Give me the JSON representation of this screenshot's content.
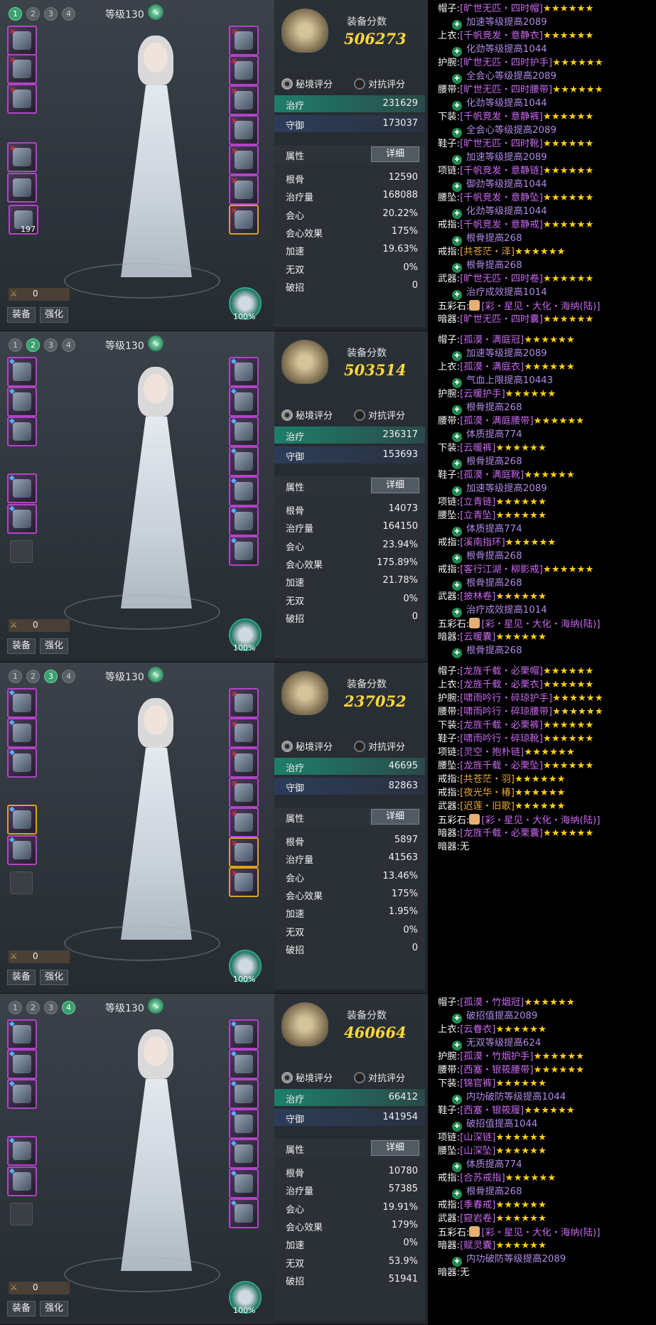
{
  "panels": [
    {
      "tabs": [
        "1",
        "2",
        "3",
        "4"
      ],
      "active_tab": 0,
      "level": "等级130",
      "slot_count": "197",
      "bottom_value": "0",
      "btn_equip": "装备",
      "btn_enhance": "强化",
      "pet_pct": "100%",
      "score_label": "装备分数",
      "score": "506273",
      "radio_a": "秘境评分",
      "radio_b": "对抗评分",
      "heal_k": "治疗",
      "heal_v": "231629",
      "def_k": "守御",
      "def_v": "173037",
      "attr_title": "属性",
      "detail_btn": "详细",
      "attrs": [
        [
          "根骨",
          "12590"
        ],
        [
          "治疗量",
          "168088"
        ],
        [
          "会心",
          "20.22%"
        ],
        [
          "会心效果",
          "175%"
        ],
        [
          "加速",
          "19.63%"
        ],
        [
          "无双",
          "0%"
        ],
        [
          "破招",
          "0"
        ]
      ]
    },
    {
      "tabs": [
        "1",
        "2",
        "3",
        "4"
      ],
      "active_tab": 1,
      "level": "等级130",
      "slot_count": "",
      "bottom_value": "0",
      "btn_equip": "装备",
      "btn_enhance": "强化",
      "pet_pct": "100%",
      "score_label": "装备分数",
      "score": "503514",
      "radio_a": "秘境评分",
      "radio_b": "对抗评分",
      "heal_k": "治疗",
      "heal_v": "236317",
      "def_k": "守御",
      "def_v": "153693",
      "attr_title": "属性",
      "detail_btn": "详细",
      "attrs": [
        [
          "根骨",
          "14073"
        ],
        [
          "治疗量",
          "164150"
        ],
        [
          "会心",
          "23.94%"
        ],
        [
          "会心效果",
          "175.89%"
        ],
        [
          "加速",
          "21.78%"
        ],
        [
          "无双",
          "0%"
        ],
        [
          "破招",
          "0"
        ]
      ]
    },
    {
      "tabs": [
        "1",
        "2",
        "3",
        "4"
      ],
      "active_tab": 2,
      "level": "等级130",
      "slot_count": "",
      "bottom_value": "0",
      "btn_equip": "装备",
      "btn_enhance": "强化",
      "pet_pct": "100%",
      "score_label": "装备分数",
      "score": "237052",
      "radio_a": "秘境评分",
      "radio_b": "对抗评分",
      "heal_k": "治疗",
      "heal_v": "46695",
      "def_k": "守御",
      "def_v": "82863",
      "attr_title": "属性",
      "detail_btn": "详细",
      "attrs": [
        [
          "根骨",
          "5897"
        ],
        [
          "治疗量",
          "41563"
        ],
        [
          "会心",
          "13.46%"
        ],
        [
          "会心效果",
          "175%"
        ],
        [
          "加速",
          "1.95%"
        ],
        [
          "无双",
          "0%"
        ],
        [
          "破招",
          "0"
        ]
      ]
    },
    {
      "tabs": [
        "1",
        "2",
        "3",
        "4"
      ],
      "active_tab": 3,
      "level": "等级130",
      "slot_count": "",
      "bottom_value": "0",
      "btn_equip": "装备",
      "btn_enhance": "强化",
      "pet_pct": "100%",
      "score_label": "装备分数",
      "score": "460664",
      "radio_a": "秘境评分",
      "radio_b": "对抗评分",
      "heal_k": "治疗",
      "heal_v": "66412",
      "def_k": "守御",
      "def_v": "141954",
      "attr_title": "属性",
      "detail_btn": "详细",
      "attrs": [
        [
          "根骨",
          "10780"
        ],
        [
          "治疗量",
          "57385"
        ],
        [
          "会心",
          "19.91%"
        ],
        [
          "会心效果",
          "179%"
        ],
        [
          "加速",
          "0%"
        ],
        [
          "无双",
          "53.9%"
        ],
        [
          "破招",
          "51941"
        ]
      ]
    }
  ],
  "lists": [
    [
      {
        "k": "帽子:",
        "n": "[旷世无匹・四时帽]",
        "s": "★★★★★★"
      },
      {
        "sub": "加速等级提高2089"
      },
      {
        "k": "上衣:",
        "n": "[千帆竞发・意静衣]",
        "s": "★★★★★★"
      },
      {
        "sub": "化劲等级提高1044"
      },
      {
        "k": "护腕:",
        "n": "[旷世无匹・四时护手]",
        "s": "★★★★★★"
      },
      {
        "sub": "全会心等级提高2089"
      },
      {
        "k": "腰带:",
        "n": "[旷世无匹・四时腰带]",
        "s": "★★★★★★"
      },
      {
        "sub": "化劲等级提高1044"
      },
      {
        "k": "下装:",
        "n": "[千帆竞发・意静裤]",
        "s": "★★★★★★"
      },
      {
        "sub": "全会心等级提高2089"
      },
      {
        "k": "鞋子:",
        "n": "[旷世无匹・四时靴]",
        "s": "★★★★★★"
      },
      {
        "sub": "加速等级提高2089"
      },
      {
        "k": "项链:",
        "n": "[千帆竞发・意静链]",
        "s": "★★★★★★"
      },
      {
        "sub": "御劲等级提高1044"
      },
      {
        "k": "腰坠:",
        "n": "[千帆竞发・意静坠]",
        "s": "★★★★★★"
      },
      {
        "sub": "化劲等级提高1044"
      },
      {
        "k": "戒指:",
        "n": "[千帆竞发・意静戒]",
        "s": "★★★★★★"
      },
      {
        "sub": "根骨提高268"
      },
      {
        "k": "戒指:",
        "n": "[共苍茫・泽]",
        "s": "★★★★★★",
        "gold": true
      },
      {
        "sub": "根骨提高268"
      },
      {
        "k": "武器:",
        "n": "[旷世无匹・四时卷]",
        "s": "★★★★★★"
      },
      {
        "sub": "治疗成效提高1014"
      },
      {
        "k": "五彩石:",
        "n": "[彩・星见・大化・海纳(陆)]",
        "gem": true
      },
      {
        "k": "暗器:",
        "n": "[旷世无匹・四时囊]",
        "s": "★★★★★★"
      }
    ],
    [
      {
        "k": "帽子:",
        "n": "[孤漠・满庭冠]",
        "s": "★★★★★★"
      },
      {
        "sub": "加速等级提高2089"
      },
      {
        "k": "上衣:",
        "n": "[孤漠・满庭衣]",
        "s": "★★★★★★"
      },
      {
        "sub": "气血上限提高10443"
      },
      {
        "k": "护腕:",
        "n": "[云暖护手]",
        "s": "★★★★★★"
      },
      {
        "sub": "根骨提高268"
      },
      {
        "k": "腰带:",
        "n": "[孤漠・满庭腰带]",
        "s": "★★★★★★"
      },
      {
        "sub": "体质提高774"
      },
      {
        "k": "下装:",
        "n": "[云暖裤]",
        "s": "★★★★★★"
      },
      {
        "sub": "根骨提高268"
      },
      {
        "k": "鞋子:",
        "n": "[孤漠・满庭靴]",
        "s": "★★★★★★"
      },
      {
        "sub": "加速等级提高2089"
      },
      {
        "k": "项链:",
        "n": "[立青链]",
        "s": "★★★★★★"
      },
      {
        "k": "腰坠:",
        "n": "[立青坠]",
        "s": "★★★★★★"
      },
      {
        "sub": "体质提高774"
      },
      {
        "k": "戒指:",
        "n": "[溪南指环]",
        "s": "★★★★★★"
      },
      {
        "sub": "根骨提高268"
      },
      {
        "k": "戒指:",
        "n": "[客行江湖・柳影戒]",
        "s": "★★★★★★"
      },
      {
        "sub": "根骨提高268"
      },
      {
        "k": "武器:",
        "n": "[披林卷]",
        "s": "★★★★★★"
      },
      {
        "sub": "治疗成效提高1014"
      },
      {
        "k": "五彩石:",
        "n": "[彩・星见・大化・海纳(陆)]",
        "gem": true
      },
      {
        "k": "暗器:",
        "n": "[云暖囊]",
        "s": "★★★★★★"
      },
      {
        "sub": "根骨提高268"
      }
    ],
    [
      {
        "k": "帽子:",
        "n": "[龙旌千载・必栗帽]",
        "s": "★★★★★★"
      },
      {
        "k": "上衣:",
        "n": "[龙旌千载・必栗衣]",
        "s": "★★★★★★"
      },
      {
        "k": "护腕:",
        "n": "[啸雨吟行・碎琼护手]",
        "s": "★★★★★★"
      },
      {
        "k": "腰带:",
        "n": "[啸雨吟行・碎琼腰带]",
        "s": "★★★★★★"
      },
      {
        "k": "下装:",
        "n": "[龙旌千载・必栗裤]",
        "s": "★★★★★★"
      },
      {
        "k": "鞋子:",
        "n": "[啸雨吟行・碎琼靴]",
        "s": "★★★★★★"
      },
      {
        "k": "项链:",
        "n": "[灵空・抱朴链]",
        "s": "★★★★★★"
      },
      {
        "k": "腰坠:",
        "n": "[龙旌千载・必栗坠]",
        "s": "★★★★★★"
      },
      {
        "k": "戒指:",
        "n": "[共苍茫・羽]",
        "s": "★★★★★★",
        "gold": true
      },
      {
        "k": "戒指:",
        "n": "[夜光华・椿]",
        "s": "★★★★★★",
        "gold": true
      },
      {
        "k": "武器:",
        "n": "[迟莲・旧歌]",
        "s": "★★★★★★",
        "gold": true
      },
      {
        "k": "五彩石:",
        "n": "[彩・星见・大化・海纳(陆)]",
        "gem": true
      },
      {
        "k": "暗器:",
        "n": "[龙旌千载・必栗囊]",
        "s": "★★★★★★"
      },
      {
        "k": "暗器:",
        "plain": "无"
      }
    ],
    [
      {
        "k": "帽子:",
        "n": "[孤漠・竹烟冠]",
        "s": "★★★★★★"
      },
      {
        "sub": "破招值提高2089"
      },
      {
        "k": "上衣:",
        "n": "[云眷衣]",
        "s": "★★★★★★"
      },
      {
        "sub": "无双等级提高624"
      },
      {
        "k": "护腕:",
        "n": "[孤漠・竹烟护手]",
        "s": "★★★★★★"
      },
      {
        "k": "腰带:",
        "n": "[西塞・银筱腰带]",
        "s": "★★★★★★"
      },
      {
        "k": "下装:",
        "n": "[锦官裤]",
        "s": "★★★★★★"
      },
      {
        "sub": "内功破防等级提高1044"
      },
      {
        "k": "鞋子:",
        "n": "[西塞・银筱履]",
        "s": "★★★★★★"
      },
      {
        "sub": "破招值提高1044"
      },
      {
        "k": "项链:",
        "n": "[山深链]",
        "s": "★★★★★★"
      },
      {
        "k": "腰坠:",
        "n": "[山深坠]",
        "s": "★★★★★★"
      },
      {
        "sub": "体质提高774"
      },
      {
        "k": "戒指:",
        "n": "[合苏戒指]",
        "s": "★★★★★★"
      },
      {
        "sub": "根骨提高268"
      },
      {
        "k": "戒指:",
        "n": "[季春戒]",
        "s": "★★★★★★"
      },
      {
        "k": "武器:",
        "n": "[窥岩卷]",
        "s": "★★★★★★"
      },
      {
        "k": "五彩石:",
        "n": "[彩・星见・大化・海纳(陆)]",
        "gem": true
      },
      {
        "k": "暗器:",
        "n": "[赋灵囊]",
        "s": "★★★★★★"
      },
      {
        "sub": "内功破防等级提高2089"
      },
      {
        "k": "暗器:",
        "plain": "无"
      }
    ]
  ]
}
